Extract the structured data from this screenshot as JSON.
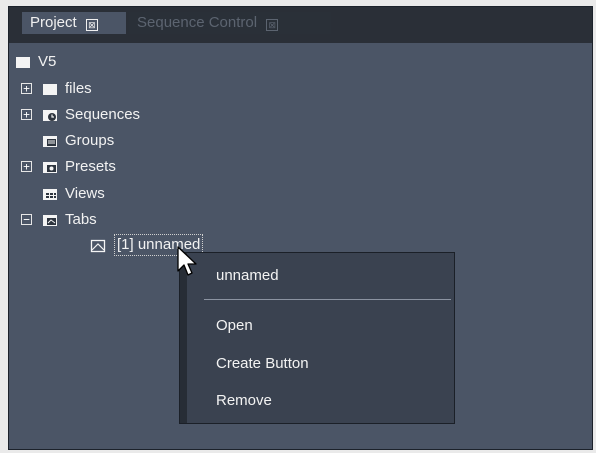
{
  "tabs": [
    {
      "label": "Project",
      "close": "⊠"
    },
    {
      "label": "Sequence Control",
      "close": "⊠"
    }
  ],
  "tree": {
    "root": "V5",
    "items": [
      {
        "label": "files",
        "expander": "+"
      },
      {
        "label": "Sequences",
        "expander": "+"
      },
      {
        "label": "Groups"
      },
      {
        "label": "Presets",
        "expander": "+"
      },
      {
        "label": "Views"
      },
      {
        "label": "Tabs",
        "expander": "−"
      }
    ],
    "child": {
      "label": "[1] unnamed"
    }
  },
  "context_menu": {
    "title": "unnamed",
    "items": [
      "Open",
      "Create Button",
      "Remove"
    ]
  },
  "colors": {
    "panel_bg": "#4b5566",
    "tabbar_bg": "#2a2f37",
    "menu_bg": "#3a4250"
  }
}
